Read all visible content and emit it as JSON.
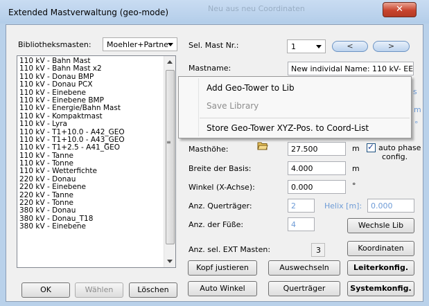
{
  "window": {
    "title": "Extended Mastverwaltung (geo-mode)",
    "title_ghost": "Neu aus neu Coordinaten",
    "close_symbol": "✕"
  },
  "library": {
    "label": "Bibliotheksmasten:",
    "selected": "Moehler+Partne",
    "items": [
      "110 kV - Bahn Mast",
      "110 kV - Bahn Mast x2",
      "110 kV - Donau BMP",
      "110 kV - Donau PCX",
      "110 kV - Einebene",
      "110 kV - Einebene BMP",
      "110 kV - Energie/Bahn Mast",
      "110 kV - Kompaktmast",
      "110 kV - Lyra",
      "110 kV - T1+10.0 - A42_GEO",
      "110 kV - T1+10.0 - A43_GEO",
      "110 kV - T1+2.5 - A41_GEO",
      "110 kV - Tanne",
      "110 kV - Tonne",
      "110 kV - Wetterfichte",
      "220 kV - Donau",
      "220 kV - Einebene",
      "220 kV - Tanne",
      "220 kV - Tonne",
      "380 kV - Donau",
      "380 kV - Donau_T18",
      "380 kV - Einebene"
    ],
    "scroll_grip": "≡"
  },
  "bottom_buttons": {
    "ok": "OK",
    "waehlen": "Wählen",
    "loeschen": "Löschen"
  },
  "mast": {
    "sel_label": "Sel. Mast Nr.:",
    "sel_value": "1",
    "prev_label": "<",
    "next_label": ">",
    "name_label": "Mastname:",
    "name_value": "New individal Name: 110 kV- EE",
    "hoehe_label": "Masthöhe:",
    "hoehe_value": "27.500",
    "hoehe_unit": "m",
    "auto_phase_label": "auto phase",
    "auto_phase_label2": "config.",
    "auto_phase_checked": true,
    "breite_label": "Breite der Basis:",
    "breite_value": "4.000",
    "breite_unit": "m",
    "winkel_label": "Winkel (X-Achse):",
    "winkel_value": "0.000",
    "winkel_unit": "°",
    "quertraeger_label": "Anz. Querträger:",
    "quertraeger_value": "2",
    "helix_label": "Helix [m]:",
    "helix_value": "0.000",
    "fuesse_label": "Anz. der Füße:",
    "fuesse_value": "4",
    "ext_label": "Anz. sel. EXT Masten:",
    "ext_value": "3"
  },
  "partial_right": {
    "s_char": "s",
    "m_char": "m",
    "deg_char": "°"
  },
  "action_buttons": {
    "wechsle_lib": "Wechsle Lib",
    "koordinaten": "Koordinaten",
    "kopf_justieren": "Kopf justieren",
    "auswechseln": "Auswechseln",
    "leiterkonfig": "Leiterkonfig.",
    "auto_winkel": "Auto Winkel",
    "quertraeger": "Querträger",
    "systemkonfig": "Systemkonfig."
  },
  "context_menu": {
    "items": [
      "Add Geo-Tower to Lib",
      "Save Library",
      "Store Geo-Tower XYZ-Pos. to Coord-List"
    ],
    "disabled": [
      false,
      true,
      false
    ]
  },
  "colors": {
    "accent_blue": "#6d9bd6",
    "close_red": "#c8442e"
  }
}
